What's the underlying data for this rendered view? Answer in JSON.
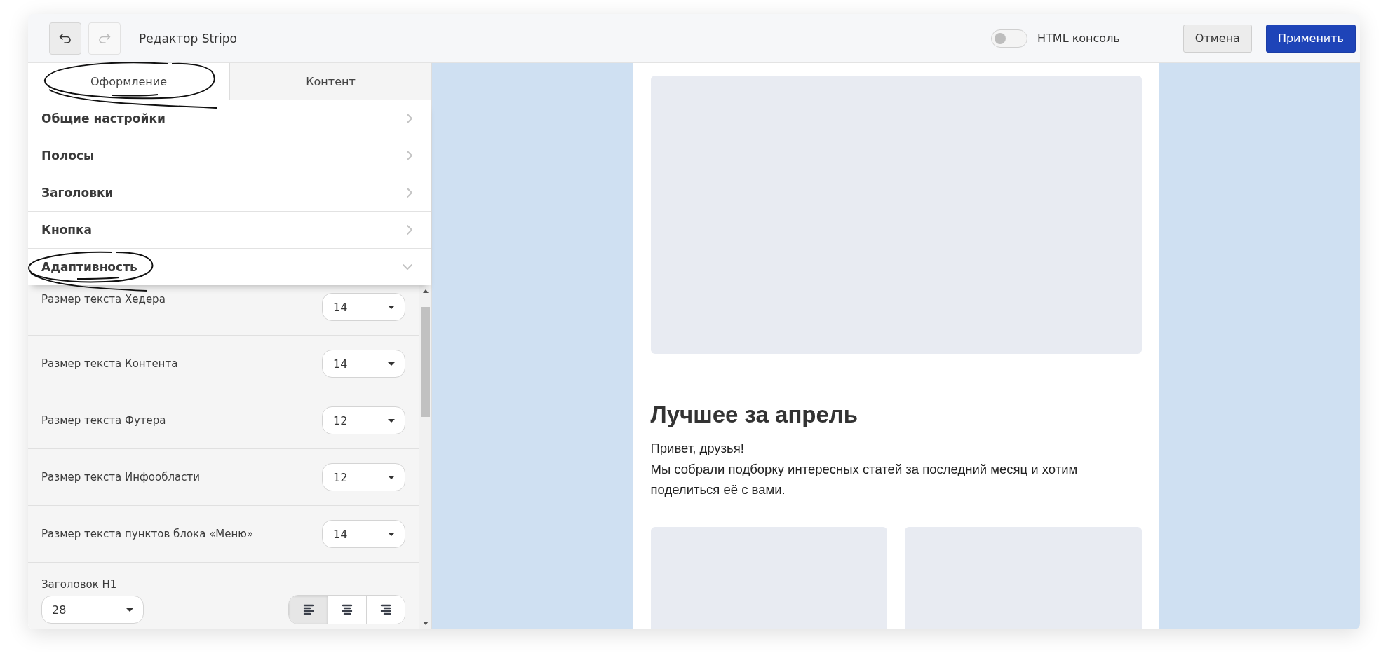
{
  "toolbar": {
    "undo": {
      "disabled": false
    },
    "redo": {
      "disabled": true
    },
    "title": "Редактор Stripo",
    "html_console": {
      "label": "HTML консоль",
      "on": false
    },
    "buttons": [
      {
        "label": "Отмена",
        "kind": "secondary"
      },
      {
        "label": "Применить",
        "kind": "primary"
      }
    ]
  },
  "tabs": [
    {
      "label": "Оформление",
      "selected": true
    },
    {
      "label": "Контент",
      "selected": false
    }
  ],
  "sections": [
    {
      "label": "Общие настройки",
      "expanded": false
    },
    {
      "label": "Полосы",
      "expanded": false
    },
    {
      "label": "Заголовки",
      "expanded": false
    },
    {
      "label": "Кнопка",
      "expanded": false
    },
    {
      "label": "Адаптивность",
      "expanded": true
    }
  ],
  "settings": [
    {
      "label": "Размер текста Хедера",
      "value": "14"
    },
    {
      "label": "Размер текста Контента",
      "value": "14"
    },
    {
      "label": "Размер текста Футера",
      "value": "12"
    },
    {
      "label": "Размер текста Инфообласти",
      "value": "12"
    },
    {
      "label": "Размер текста пунктов блока «Меню»",
      "value": "14"
    }
  ],
  "h1": {
    "label": "Заголовок H1",
    "value": "28",
    "align": [
      {
        "kind": "left",
        "selected": true
      },
      {
        "kind": "center",
        "selected": false
      },
      {
        "kind": "right",
        "selected": false
      }
    ]
  },
  "email": {
    "heading": "Лучшее за апрель",
    "lines": [
      "Привет, друзья!",
      "Мы собрали подборку интересных статей за последний месяц и хотим поделиться её с вами."
    ]
  }
}
